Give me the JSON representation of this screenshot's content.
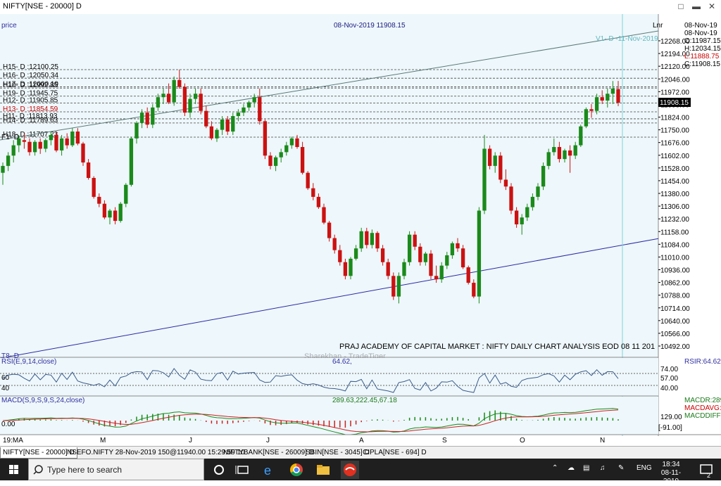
{
  "window": {
    "title": "NIFTY[NSE - 20000] D"
  },
  "header": {
    "price_label": "price",
    "date_price": "08-Nov-2019 11908.15",
    "scale_label": "Lnr"
  },
  "ohlc": {
    "dates": [
      "08-Nov-19",
      "08-Nov-19"
    ],
    "open": "O:11987.15",
    "high": "H:12034.15",
    "low": "L:11888.75",
    "close": "C:11908.15"
  },
  "vline_label": "V1- D -11-Nov-2019",
  "current_price": "11908.15",
  "levels": [
    {
      "label": "H15- D :12100.25",
      "value": 12100.25
    },
    {
      "label": "H16- D :12050.34",
      "value": 12050.34
    },
    {
      "label": "H17- D :12000.19",
      "value": 12000.19
    },
    {
      "label": "H10- D :11992.85",
      "value": 11992.85
    },
    {
      "label": "H19- D :11945.75",
      "value": 11945.75
    },
    {
      "label": "H12- D :11905.85",
      "value": 11905.85
    },
    {
      "label": "H13- D :11854.59",
      "value": 11854.59,
      "color": "#cc0000"
    },
    {
      "label": "H11- D :11813.93",
      "value": 11813.93
    },
    {
      "label": "H14- D :11789.63",
      "value": 11789.63
    },
    {
      "label": "H18- D :11707.23",
      "value": 11707.23
    }
  ],
  "f1_label": "F1- D",
  "t8_label": "T8- D",
  "annotation": "PRAJ ACADEMY OF CAPITAL MARKET : NIFTY DAILY CHART ANALYSIS EOD 08 11 201",
  "watermark": "Sharekhan - TradeTiger",
  "rsi": {
    "label": "RSI(E,9,14,close)",
    "value": "64.62,",
    "right_label": "RSIR:64.62",
    "ticks": [
      "74.00",
      "57.00",
      "40.00"
    ],
    "left_ticks": [
      "60",
      "40"
    ]
  },
  "macd": {
    "label": "MACD(S,9,S,9,S,24,close)",
    "values": "289.63,222.45,67.18",
    "legend": [
      "MACDR:289",
      "MACDAVG:",
      "MACDDIFF:"
    ],
    "ticks": [
      "129.00",
      "[-91.00]"
    ],
    "left_tick": "0.00"
  },
  "x_axis": {
    "start": "19:MA",
    "months": [
      "M",
      "J",
      "J",
      "A",
      "S",
      "O",
      "N"
    ]
  },
  "chart_data": {
    "type": "candlestick",
    "title": "NIFTY[NSE - 20000] D",
    "ylim": [
      10492,
      12268
    ],
    "y_ticks": [
      "12268.00",
      "12194.00",
      "12120.00",
      "12046.00",
      "11972.00",
      "11898.00",
      "11824.00",
      "11750.00",
      "11676.00",
      "11602.00",
      "11528.00",
      "11454.00",
      "11380.00",
      "11306.00",
      "11232.00",
      "11158.00",
      "11084.00",
      "11010.00",
      "10936.00",
      "10862.00",
      "10788.00",
      "10714.00",
      "10640.00",
      "10566.00",
      "10492.00"
    ],
    "ohlc": [
      [
        11500,
        11560,
        11430,
        11540
      ],
      [
        11540,
        11620,
        11510,
        11600
      ],
      [
        11600,
        11690,
        11560,
        11660
      ],
      [
        11660,
        11720,
        11620,
        11700
      ],
      [
        11690,
        11730,
        11640,
        11680
      ],
      [
        11680,
        11700,
        11600,
        11620
      ],
      [
        11620,
        11690,
        11600,
        11680
      ],
      [
        11680,
        11700,
        11610,
        11640
      ],
      [
        11640,
        11700,
        11620,
        11690
      ],
      [
        11690,
        11740,
        11660,
        11720
      ],
      [
        11720,
        11740,
        11620,
        11630
      ],
      [
        11630,
        11720,
        11600,
        11700
      ],
      [
        11700,
        11730,
        11640,
        11660
      ],
      [
        11660,
        11760,
        11650,
        11740
      ],
      [
        11740,
        11760,
        11660,
        11670
      ],
      [
        11670,
        11680,
        11540,
        11560
      ],
      [
        11560,
        11580,
        11460,
        11470
      ],
      [
        11470,
        11480,
        11350,
        11360
      ],
      [
        11360,
        11380,
        11300,
        11320
      ],
      [
        11320,
        11340,
        11230,
        11240
      ],
      [
        11240,
        11290,
        11200,
        11280
      ],
      [
        11280,
        11300,
        11200,
        11220
      ],
      [
        11220,
        11330,
        11210,
        11320
      ],
      [
        11320,
        11440,
        11300,
        11430
      ],
      [
        11430,
        11710,
        11420,
        11700
      ],
      [
        11700,
        11800,
        11670,
        11790
      ],
      [
        11790,
        11870,
        11760,
        11850
      ],
      [
        11850,
        11880,
        11760,
        11780
      ],
      [
        11780,
        11900,
        11760,
        11880
      ],
      [
        11880,
        11960,
        11860,
        11940
      ],
      [
        11940,
        11990,
        11900,
        11960
      ],
      [
        11960,
        12020,
        11900,
        11910
      ],
      [
        11910,
        12060,
        11890,
        12040
      ],
      [
        12040,
        12100,
        11990,
        12000
      ],
      [
        12000,
        12020,
        11830,
        11850
      ],
      [
        11850,
        11960,
        11820,
        11930
      ],
      [
        11930,
        11990,
        11900,
        11960
      ],
      [
        11960,
        11990,
        11840,
        11860
      ],
      [
        11860,
        11890,
        11760,
        11770
      ],
      [
        11770,
        11800,
        11690,
        11700
      ],
      [
        11700,
        11760,
        11680,
        11750
      ],
      [
        11750,
        11830,
        11720,
        11810
      ],
      [
        11810,
        11830,
        11720,
        11740
      ],
      [
        11740,
        11850,
        11720,
        11830
      ],
      [
        11830,
        11870,
        11800,
        11850
      ],
      [
        11850,
        11900,
        11830,
        11880
      ],
      [
        11880,
        11920,
        11860,
        11910
      ],
      [
        11910,
        11960,
        11880,
        11940
      ],
      [
        11940,
        11990,
        11780,
        11800
      ],
      [
        11800,
        11810,
        11580,
        11600
      ],
      [
        11600,
        11620,
        11520,
        11540
      ],
      [
        11540,
        11600,
        11510,
        11590
      ],
      [
        11590,
        11640,
        11560,
        11620
      ],
      [
        11620,
        11680,
        11600,
        11660
      ],
      [
        11660,
        11710,
        11640,
        11700
      ],
      [
        11700,
        11720,
        11640,
        11650
      ],
      [
        11650,
        11680,
        11490,
        11500
      ],
      [
        11500,
        11510,
        11400,
        11410
      ],
      [
        11410,
        11440,
        11340,
        11360
      ],
      [
        11360,
        11380,
        11290,
        11300
      ],
      [
        11300,
        11320,
        11200,
        11210
      ],
      [
        11210,
        11220,
        11100,
        11120
      ],
      [
        11120,
        11140,
        11030,
        11050
      ],
      [
        11050,
        11080,
        10960,
        10980
      ],
      [
        10980,
        11000,
        10880,
        10900
      ],
      [
        10900,
        11010,
        10880,
        11000
      ],
      [
        11000,
        11080,
        10990,
        11060
      ],
      [
        11060,
        11180,
        11040,
        11160
      ],
      [
        11160,
        11180,
        11060,
        11080
      ],
      [
        11080,
        11170,
        11060,
        11150
      ],
      [
        11150,
        11160,
        11040,
        11060
      ],
      [
        11060,
        11080,
        10960,
        10980
      ],
      [
        10980,
        11000,
        10880,
        10900
      ],
      [
        10900,
        10920,
        10760,
        10780
      ],
      [
        10780,
        10920,
        10740,
        10900
      ],
      [
        10900,
        11000,
        10880,
        10980
      ],
      [
        10980,
        11160,
        10960,
        11140
      ],
      [
        11140,
        11160,
        11050,
        11070
      ],
      [
        11070,
        11090,
        10960,
        10980
      ],
      [
        10980,
        11040,
        10960,
        11030
      ],
      [
        11030,
        11050,
        10880,
        10900
      ],
      [
        10900,
        10960,
        10860,
        10880
      ],
      [
        10880,
        10980,
        10860,
        10960
      ],
      [
        10960,
        11040,
        10940,
        11020
      ],
      [
        11020,
        11100,
        11000,
        11090
      ],
      [
        11090,
        11120,
        11040,
        11060
      ],
      [
        11060,
        11080,
        10940,
        10950
      ],
      [
        10950,
        10960,
        10850,
        10860
      ],
      [
        10860,
        10880,
        10770,
        10780
      ],
      [
        10780,
        11300,
        10740,
        11280
      ],
      [
        11280,
        11720,
        11260,
        11640
      ],
      [
        11640,
        11660,
        11520,
        11540
      ],
      [
        11540,
        11620,
        11500,
        11600
      ],
      [
        11600,
        11620,
        11440,
        11460
      ],
      [
        11460,
        11520,
        11400,
        11420
      ],
      [
        11420,
        11440,
        11260,
        11280
      ],
      [
        11280,
        11300,
        11180,
        11200
      ],
      [
        11200,
        11260,
        11140,
        11240
      ],
      [
        11240,
        11320,
        11220,
        11300
      ],
      [
        11300,
        11380,
        11280,
        11360
      ],
      [
        11360,
        11440,
        11340,
        11420
      ],
      [
        11420,
        11560,
        11400,
        11540
      ],
      [
        11540,
        11640,
        11520,
        11620
      ],
      [
        11620,
        11700,
        11600,
        11650
      ],
      [
        11650,
        11680,
        11560,
        11580
      ],
      [
        11580,
        11640,
        11560,
        11630
      ],
      [
        11630,
        11660,
        11500,
        11600
      ],
      [
        11600,
        11680,
        11580,
        11660
      ],
      [
        11660,
        11780,
        11650,
        11770
      ],
      [
        11770,
        11880,
        11760,
        11870
      ],
      [
        11870,
        11900,
        11820,
        11860
      ],
      [
        11860,
        11960,
        11840,
        11940
      ],
      [
        11940,
        11980,
        11900,
        11920
      ],
      [
        11920,
        11990,
        11880,
        11960
      ],
      [
        11960,
        12034,
        11900,
        11990
      ],
      [
        11987,
        12034,
        11888,
        11908
      ]
    ],
    "trendlines": [
      {
        "name": "upper",
        "from": [
          0,
          11740
        ],
        "to": [
          133,
          12268
        ]
      },
      {
        "name": "lower",
        "from": [
          0,
          10470
        ],
        "to": [
          133,
          11060
        ]
      }
    ]
  },
  "taskbar": {
    "search_placeholder": "Type here to search",
    "lang": "ENG",
    "time": "18:34",
    "date": "08-11-2019",
    "notif_count": "2"
  },
  "colors": {
    "bg": "#eef7fb",
    "up": "#1a8a1a",
    "down": "#cc1111",
    "grid": "#444444",
    "upper_line": "#5b7a7a",
    "lower_line": "#2a2aa8"
  },
  "tabs": [
    "NIFTY[NSE - 20000] D",
    "NSEFO.NIFTY 28-Nov-2019 150@11940.00 15:29:59 10",
    "NIFTYBANK[NSE - 26009] D",
    "SBIN[NSE - 3045] D",
    "CIPLA[NSE - 694] D"
  ]
}
